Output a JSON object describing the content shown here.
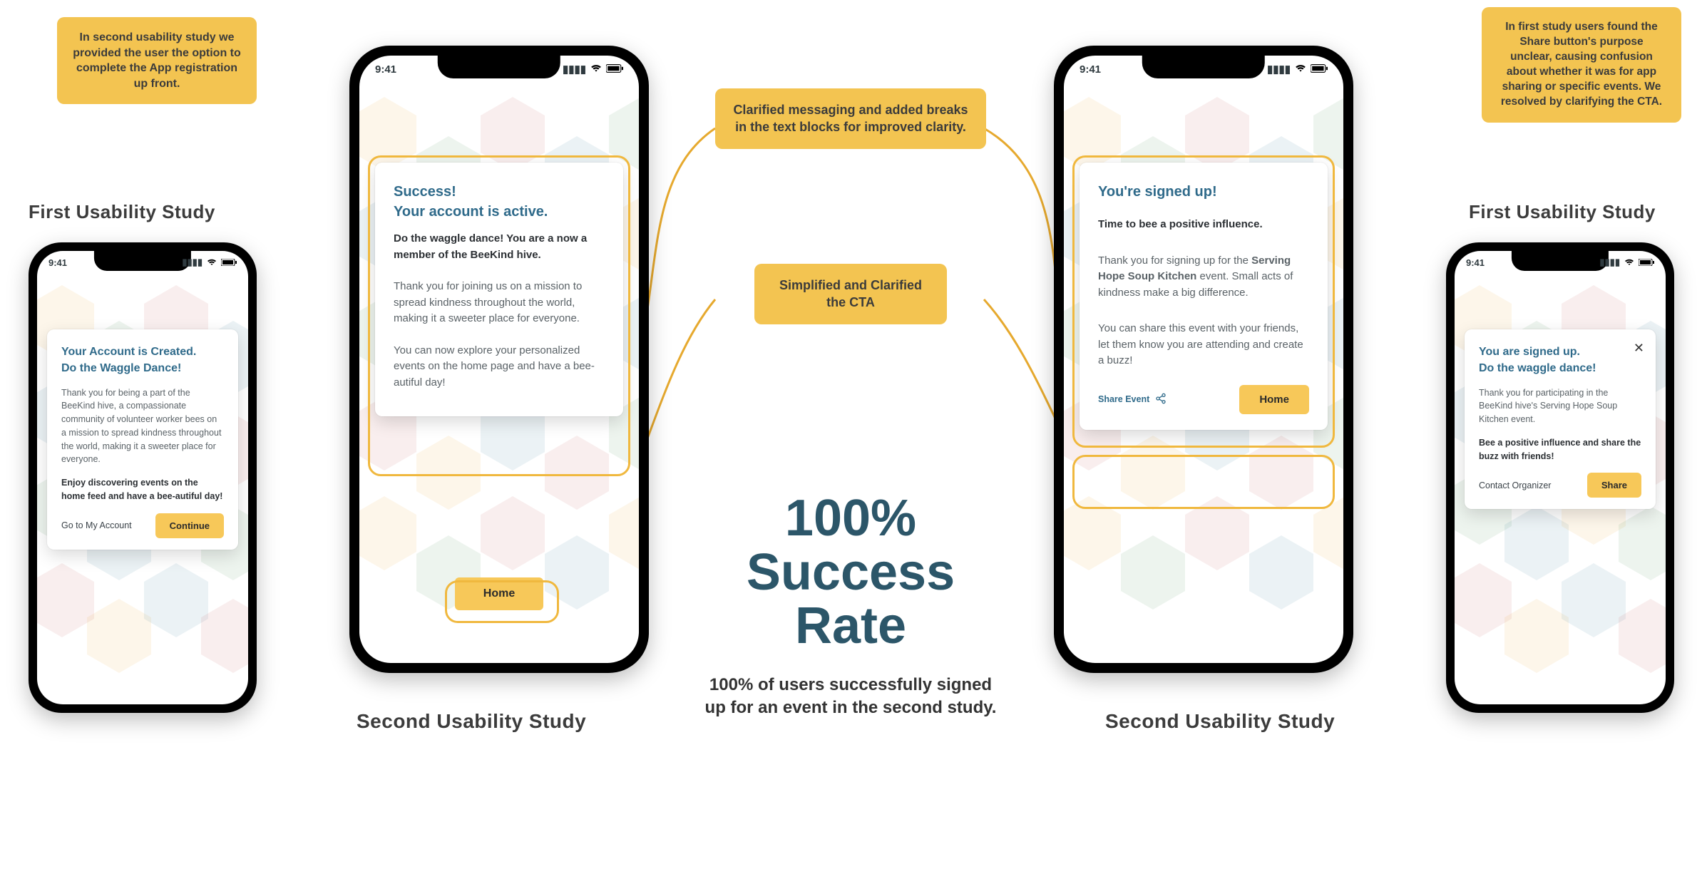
{
  "status_time": "9:41",
  "notes": {
    "top_left": "In second usability study we provided the user the option to complete the App registration up front.",
    "top_right": "In first study users found the Share button's purpose unclear, causing confusion about whether it was for app sharing or specific events.  We resolved by clarifying the CTA.",
    "mid_top": "Clarified messaging and added breaks in the text blocks for improved clarity.",
    "mid_low": "Simplified and Clarified the CTA"
  },
  "labels": {
    "first_left": "First Usability Study",
    "second_left": "Second Usability Study",
    "second_right": "Second Usability Study",
    "first_right": "First Usability Study"
  },
  "stat": {
    "line1": "100%",
    "line2": "Success",
    "line3": "Rate",
    "caption": "100% of users successfully signed up for an event in the second study."
  },
  "phone1": {
    "title1": "Your Account is Created.",
    "title2": "Do the Waggle Dance!",
    "body": "Thank you for being a part of the BeeKind hive, a compassionate community of volunteer worker bees on a mission to spread kindness throughout the world, making it a sweeter place for everyone.",
    "bold": "Enjoy discovering events on the home feed and have a bee-autiful day!",
    "secondary": "Go to My Account",
    "primary": "Continue"
  },
  "phone2": {
    "title1": "Success!",
    "title2": "Your account is active.",
    "lead": "Do the waggle dance! You are a now a member of the BeeKind hive.",
    "body1": "Thank you for joining us on a mission to spread kindness throughout the world, making it a sweeter place for everyone.",
    "body2": "You can now explore your personalized events on the home page and have a bee-autiful day!",
    "primary": "Home"
  },
  "phone3": {
    "title": "You're signed up!",
    "lead": "Time to bee a positive influence.",
    "body1_a": "Thank you for signing up for the ",
    "body1_bold": "Serving Hope Soup Kitchen",
    "body1_b": " event. Small acts of kindness make a big difference.",
    "body2": "You can share this event with your friends, let them know you are attending and create a buzz!",
    "share": "Share Event",
    "primary": "Home"
  },
  "phone4": {
    "title1": "You are signed up.",
    "title2": "Do the waggle dance!",
    "body": "Thank you for participating in the BeeKind hive's Serving Hope Soup Kitchen event.",
    "bold": "Bee a positive influence and share the buzz with friends!",
    "secondary": "Contact Organizer",
    "primary": "Share"
  }
}
